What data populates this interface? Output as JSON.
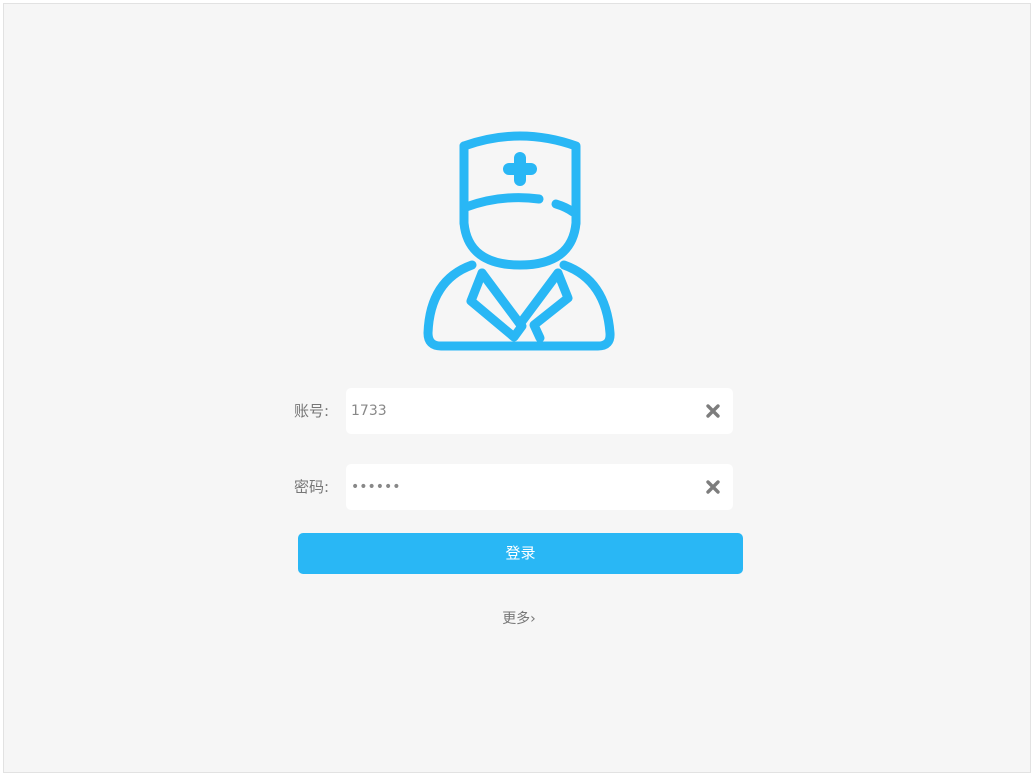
{
  "login": {
    "account_label": "账号:",
    "account_value": "1733",
    "password_label": "密码:",
    "password_value": "123456",
    "submit_label": "登录",
    "more_label": "更多›"
  },
  "icons": {
    "avatar": "doctor-avatar-icon",
    "clear": "clear-x-icon"
  },
  "colors": {
    "accent": "#29b7f5",
    "background": "#f6f6f6",
    "label": "#777777"
  }
}
